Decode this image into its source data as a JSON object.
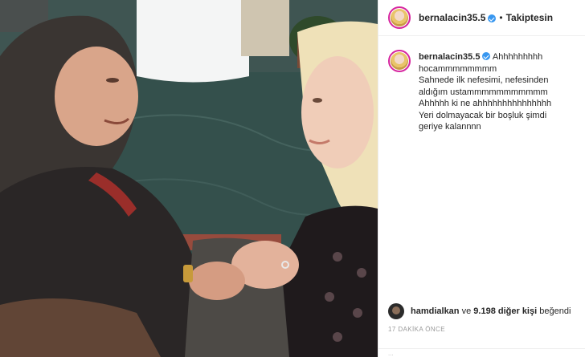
{
  "post": {
    "username": "bernalacin35.5",
    "header_separator": "•",
    "follow_label": "Takiptesin",
    "caption_lines": [
      "Ahhhhhhhhh",
      "hocammmmmmmm",
      "Sahnede ilk nefesimi, nefesinden",
      "aldığım ustammmmmmmmmmm",
      "Ahhhhh ki ne ahhhhhhhhhhhhhhh",
      "Yeri dolmayacak bir boşluk şimdi",
      "geriye kalannnn"
    ],
    "likes": {
      "liker": "hamdialkan",
      "connector": "ve",
      "others": "9.198 diğer kişi",
      "suffix": "beğendi"
    },
    "timestamp": "17 DAKİKA ÖNCE",
    "comment_placeholder": "..."
  },
  "icons": {
    "verified": "verified-badge-icon",
    "avatar": "profile-avatar"
  },
  "colors": {
    "verified_blue": "#3897f0",
    "story_ring": "#d6249f",
    "text": "#262626",
    "muted": "#999999"
  }
}
